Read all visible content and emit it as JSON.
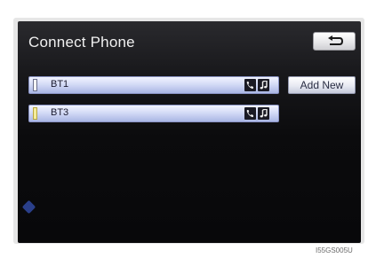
{
  "screen": {
    "title": "Connect Phone",
    "back_icon": "return-arrow-icon",
    "devices": [
      {
        "name": "BT1",
        "active": false,
        "services": [
          "phone-icon",
          "music-icon"
        ]
      },
      {
        "name": "BT3",
        "active": true,
        "services": [
          "phone-icon",
          "music-icon"
        ]
      }
    ],
    "add_new_label": "Add New"
  },
  "figure": {
    "code": "I55GS005U"
  },
  "colors": {
    "screen_bg": "#0b0b0d",
    "row_bg": "#c8d0f0",
    "active_indicator": "#f4ec9a",
    "button_bg": "#e7e9f2"
  }
}
